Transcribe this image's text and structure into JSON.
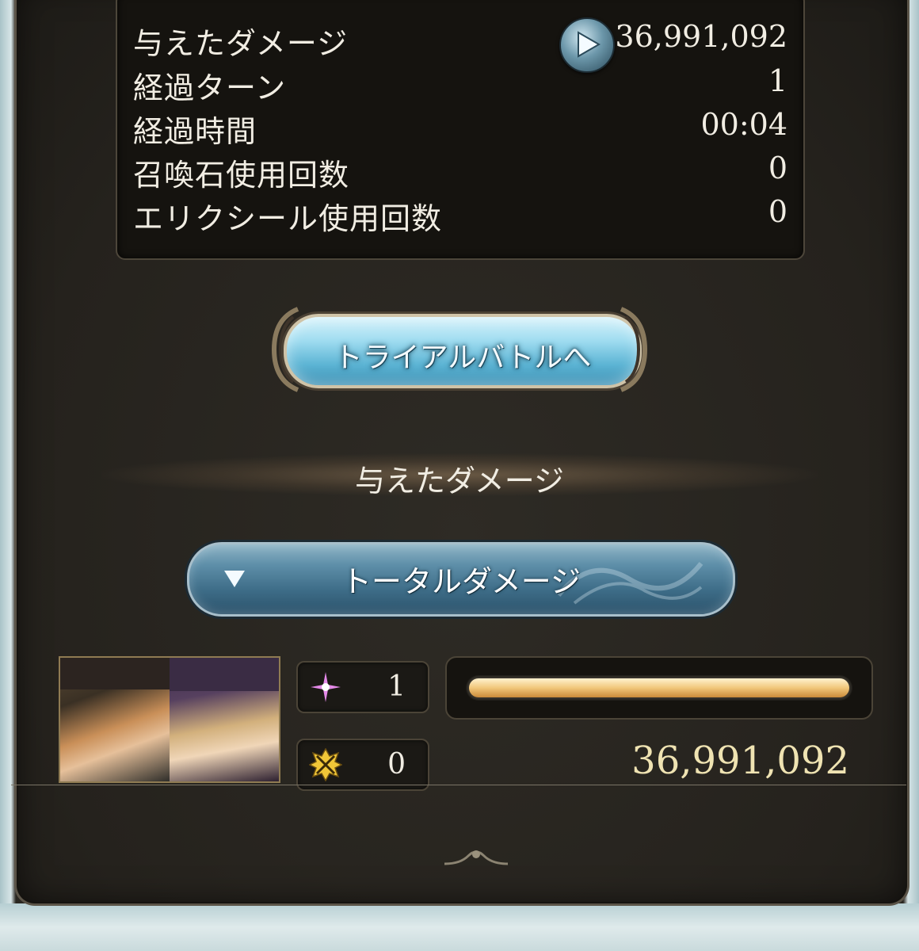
{
  "stats": {
    "rows": [
      {
        "label": "与えたダメージ",
        "value": "36,991,092"
      },
      {
        "label": "経過ターン",
        "value": "1"
      },
      {
        "label": "経過時間",
        "value": "00:04"
      },
      {
        "label": "召喚石使用回数",
        "value": "0"
      },
      {
        "label": "エリクシール使用回数",
        "value": "0"
      }
    ]
  },
  "trial_button": {
    "label": "トライアルバトルへ"
  },
  "damage_section": {
    "title": "与えたダメージ"
  },
  "dropdown": {
    "selected": "トータルダメージ"
  },
  "character": {
    "ougi_count": "1",
    "chain_count": "0",
    "hp_fill_fraction": 1.0,
    "damage": "36,991,092"
  },
  "colors": {
    "accent": "#6c97aa",
    "hp_bar": "#f1c77a",
    "damage_text": "#efe3b2"
  }
}
